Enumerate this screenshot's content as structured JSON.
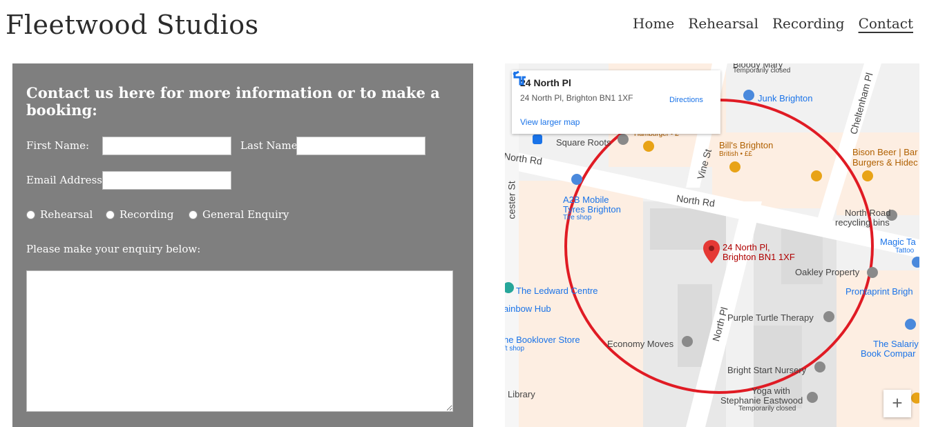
{
  "header": {
    "brand": "Fleetwood Studios",
    "nav": [
      {
        "label": "Home"
      },
      {
        "label": "Rehearsal"
      },
      {
        "label": "Recording"
      },
      {
        "label": "Contact",
        "active": true
      }
    ]
  },
  "form": {
    "title": "Contact us here for more information or to make a booking:",
    "first_name_label": "First Name:",
    "last_name_label": "Last Name:",
    "email_label": "Email Address:",
    "radio_options": [
      "Rehearsal",
      "Recording",
      "General Enquiry"
    ],
    "enquiry_label": "Please make your enquiry below:"
  },
  "map": {
    "card_title": "24 North Pl",
    "card_address": "24 North Pl, Brighton BN1 1XF",
    "directions_label": "Directions",
    "view_larger": "View larger map",
    "marker_line1": "24 North Pl,",
    "marker_line2": "Brighton BN1 1XF",
    "roads": [
      "North Rd",
      "North Rd",
      "Vine St",
      "North Pl",
      "Cheltenham Pl",
      "cester St"
    ],
    "places": {
      "bloody_mary": "Bloody Mary",
      "temporarily_closed_1": "Temporarily closed",
      "junk_brighton": "Junk Brighton",
      "hamburger": "Hamburger • £",
      "square_roots": "Square Roots",
      "bills_brighton": "Bill's Brighton",
      "bills_sub": "British • ££",
      "bison_beer": "Bison Beer | Bar",
      "bison_sub": "Burgers & Hidec",
      "a2b_1": "A2B Mobile",
      "a2b_2": "Tyres Brighton",
      "a2b_sub": "Tire shop",
      "north_road_1": "North Road",
      "north_road_2": "recycling bins",
      "magic_1": "Magic Ta",
      "magic_2": "Tattoo",
      "oakley": "Oakley Property",
      "prontaprint": "Prontaprint Brigh",
      "ledward": "The Ledward Centre",
      "rainbow": "ainbow Hub",
      "purple_turtle": "Purple Turtle Therapy",
      "booklover": "he Booklover Store",
      "booklover_sub": "ft shop",
      "economy": "Economy Moves",
      "salary_1": "The Salariy",
      "salary_2": "Book Compar",
      "bright_start": "Bright Start Nursery",
      "yoga_1": "Yoga with",
      "yoga_2": "Stephanie Eastwood",
      "temporarily_closed_2": "Temporarily closed",
      "library": "Library"
    },
    "zoom_in": "+",
    "highlight_color": "#e01b24"
  }
}
